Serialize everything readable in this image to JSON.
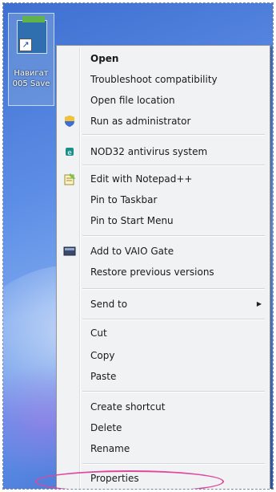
{
  "desktop": {
    "shortcut_caption": "Навигат 005 Save"
  },
  "menu": {
    "open": "Open",
    "troubleshoot": "Troubleshoot compatibility",
    "open_location": "Open file location",
    "run_admin": "Run as administrator",
    "nod32": "NOD32 antivirus system",
    "edit_notepad": "Edit with Notepad++",
    "pin_taskbar": "Pin to Taskbar",
    "pin_start": "Pin to Start Menu",
    "add_vaio": "Add to VAIO Gate",
    "restore": "Restore previous versions",
    "send_to": "Send to",
    "cut": "Cut",
    "copy": "Copy",
    "paste": "Paste",
    "create_shortcut": "Create shortcut",
    "delete": "Delete",
    "rename": "Rename",
    "properties": "Properties"
  },
  "colors": {
    "highlight": "#e0479e"
  }
}
